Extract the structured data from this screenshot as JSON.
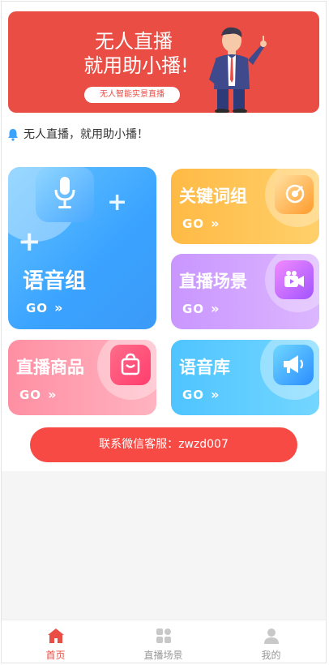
{
  "banner": {
    "title_line1": "无人直播",
    "title_line2": "就用助小播!",
    "pill": "无人智能实景直播"
  },
  "notice": {
    "text": "无人直播，就用助小播！",
    "icon": "bell-icon"
  },
  "cards": [
    {
      "title": "语音组",
      "go": "GO",
      "arrow": "»",
      "icon": "microphone-icon",
      "color": "#3aa3ff"
    },
    {
      "title": "关键词组",
      "go": "GO",
      "arrow": "»",
      "icon": "target-icon",
      "color": "#ffba45"
    },
    {
      "title": "直播场景",
      "go": "GO",
      "arrow": "»",
      "icon": "video-camera-icon",
      "color": "#c996ff"
    },
    {
      "title": "直播商品",
      "go": "GO",
      "arrow": "»",
      "icon": "shopping-bag-icon",
      "color": "#ff8fa3"
    },
    {
      "title": "语音库",
      "go": "GO",
      "arrow": "»",
      "icon": "megaphone-icon",
      "color": "#4fc4ff"
    }
  ],
  "contact": {
    "label": "联系微信客服：zwzd007"
  },
  "tabbar": {
    "items": [
      {
        "label": "首页",
        "icon": "home-icon",
        "active": true
      },
      {
        "label": "直播场景",
        "icon": "grid-icon",
        "active": false
      },
      {
        "label": "我的",
        "icon": "user-icon",
        "active": false
      }
    ],
    "active_color": "#ea4d44",
    "inactive_color": "#999999"
  }
}
